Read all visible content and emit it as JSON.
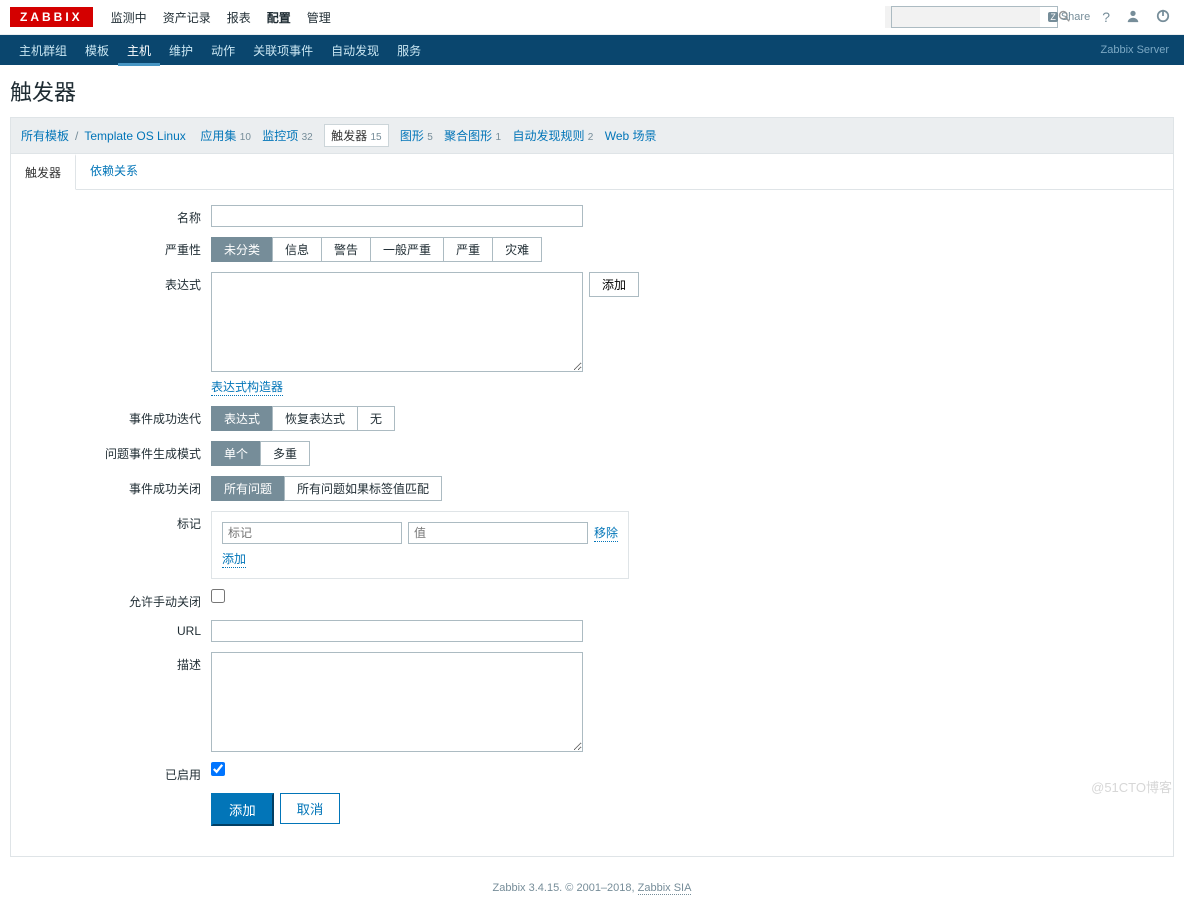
{
  "brand": "ZABBIX",
  "topnav": [
    "监测中",
    "资产记录",
    "报表",
    "配置",
    "管理"
  ],
  "topnav_active": 3,
  "share_label": "Share",
  "subnav": [
    "主机群组",
    "模板",
    "主机",
    "维护",
    "动作",
    "关联项事件",
    "自动发现",
    "服务"
  ],
  "subnav_active": 2,
  "server_label": "Zabbix Server",
  "page_title": "触发器",
  "breadcrumb": {
    "all_templates": "所有模板",
    "template_name": "Template OS Linux"
  },
  "filter_tabs": [
    {
      "label": "应用集",
      "count": "10"
    },
    {
      "label": "监控项",
      "count": "32"
    },
    {
      "label": "触发器",
      "count": "15"
    },
    {
      "label": "图形",
      "count": "5"
    },
    {
      "label": "聚合图形",
      "count": "1"
    },
    {
      "label": "自动发现规则",
      "count": "2"
    },
    {
      "label": "Web 场景",
      "count": ""
    }
  ],
  "filter_active": 2,
  "tabs": {
    "t1": "触发器",
    "t2": "依赖关系"
  },
  "labels": {
    "name": "名称",
    "severity": "严重性",
    "expression": "表达式",
    "expr_add": "添加",
    "expr_builder": "表达式构造器",
    "ok_event_gen": "事件成功迭代",
    "problem_mode": "问题事件生成模式",
    "ok_close": "事件成功关闭",
    "tags": "标记",
    "tag_remove": "移除",
    "tag_add": "添加",
    "allow_manual": "允许手动关闭",
    "url": "URL",
    "description": "描述",
    "enabled": "已启用"
  },
  "severity_opts": [
    "未分类",
    "信息",
    "警告",
    "一般严重",
    "严重",
    "灾难"
  ],
  "severity_sel": 0,
  "ok_gen_opts": [
    "表达式",
    "恢复表达式",
    "无"
  ],
  "ok_gen_sel": 0,
  "problem_mode_opts": [
    "单个",
    "多重"
  ],
  "problem_mode_sel": 0,
  "ok_close_opts": [
    "所有问题",
    "所有问题如果标签值匹配"
  ],
  "ok_close_sel": 0,
  "tag_placeholder": {
    "name": "标记",
    "value": "值"
  },
  "enabled_checked": true,
  "buttons": {
    "submit": "添加",
    "cancel": "取消"
  },
  "footer": {
    "text": "Zabbix 3.4.15. © 2001–2018, ",
    "link": "Zabbix SIA"
  },
  "watermark": "@51CTO博客"
}
